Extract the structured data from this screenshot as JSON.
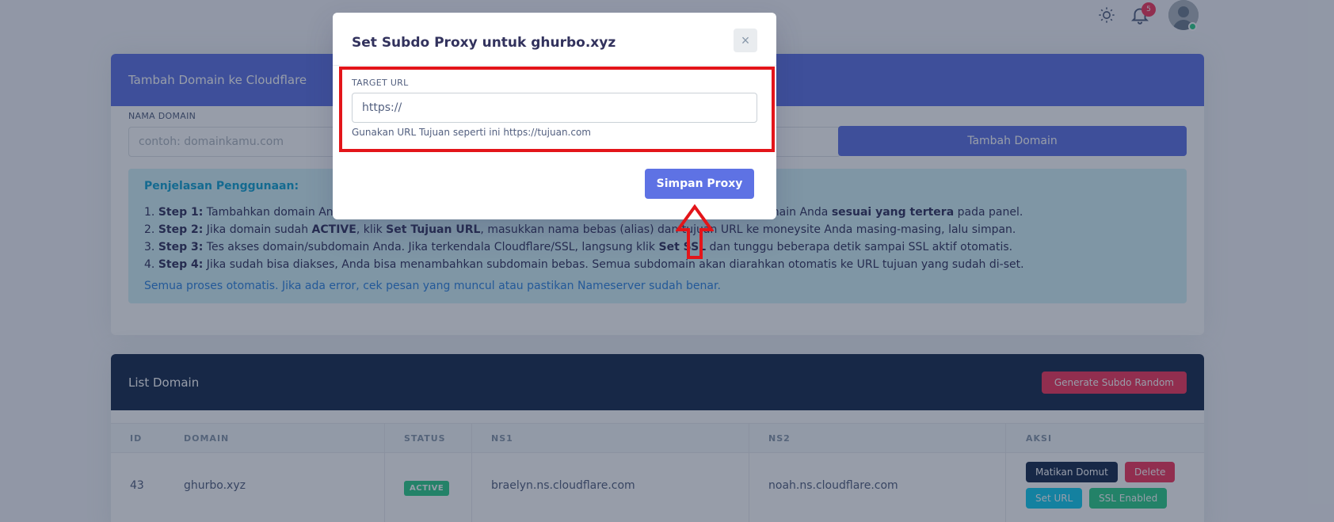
{
  "topbar": {
    "notification_count": "5",
    "theme_icon": "sun-icon",
    "bell_icon": "bell-icon"
  },
  "add_card": {
    "title": "Tambah Domain ke Cloudflare",
    "domain_label": "NAMA DOMAIN",
    "domain_placeholder": "contoh: domainkamu.com",
    "add_button": "Tambah Domain"
  },
  "guide": {
    "title": "Penjelasan Penggunaan:",
    "steps": [
      {
        "step": "Step 1:",
        "before": " Tambahkan domain Anda",
        "mid": " domain Anda ",
        "bold2": "sesuai yang tertera",
        "after": " pada panel."
      },
      {
        "step": "Step 2:",
        "text1": " Jika domain sudah ",
        "b1": "ACTIVE",
        "text2": ", klik ",
        "b2": "Set Tujuan URL",
        "text3": ", masukkan nama bebas (alias) dan tujuan URL ke moneysite Anda masing-masing, lalu simpan."
      },
      {
        "step": "Step 3:",
        "text1": " Tes akses domain/subdomain Anda. Jika terkendala Cloudflare/SSL, langsung klik ",
        "b1": "Set SSL",
        "text2": " dan tunggu beberapa detik sampai SSL aktif otomatis."
      },
      {
        "step": "Step 4:",
        "text1": " Jika sudah bisa diakses, Anda bisa menambahkan subdomain bebas. Semua subdomain akan diarahkan otomatis ke URL tujuan yang sudah di-set."
      }
    ],
    "footer": "Semua proses otomatis. Jika ada error, cek pesan yang muncul atau pastikan Nameserver sudah benar."
  },
  "list_card": {
    "title": "List Domain",
    "generate_button": "Generate Subdo Random",
    "columns": [
      "ID",
      "DOMAIN",
      "STATUS",
      "NS1",
      "NS2",
      "AKSI"
    ],
    "rows": [
      {
        "id": "43",
        "domain": "ghurbo.xyz",
        "status": "ACTIVE",
        "ns1": "braelyn.ns.cloudflare.com",
        "ns2": "noah.ns.cloudflare.com",
        "actions": [
          "Matikan Domut",
          "Delete",
          "Set URL",
          "SSL Enabled"
        ]
      }
    ]
  },
  "modal": {
    "title": "Set Subdo Proxy untuk ghurbo.xyz",
    "close_symbol": "×",
    "target_label": "TARGET URL",
    "target_value": "https://",
    "help_text": "Gunakan URL Tujuan seperti ini https://tujuan.com",
    "save_button": "Simpan Proxy"
  },
  "colors": {
    "primary": "#5e72e4",
    "dark": "#172b4d",
    "success": "#2dce89",
    "danger": "#f5365c",
    "info": "#11cdef",
    "highlight": "#e3151a"
  }
}
